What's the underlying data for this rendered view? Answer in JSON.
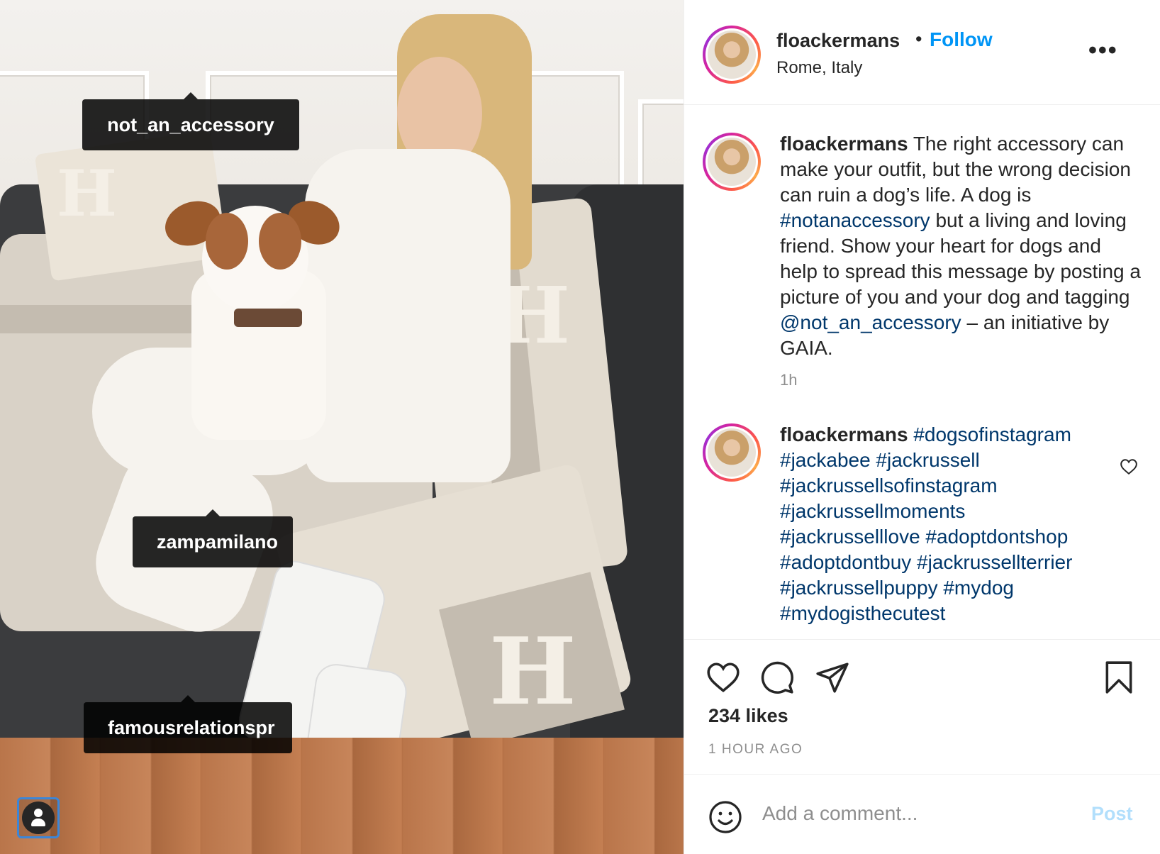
{
  "photo": {
    "tags": [
      "not_an_accessory",
      "zampamilano",
      "famousrelationspr"
    ],
    "user_tag_icon": "person-icon"
  },
  "header": {
    "username": "floackermans",
    "separator": "•",
    "follow_label": "Follow",
    "location": "Rome, Italy",
    "more_icon": "more-options-icon",
    "more_label": "•••"
  },
  "caption": {
    "username": "floackermans",
    "text_1": " The right accessory can make your outfit, but the wrong decision can ruin a dog’s life. A dog is ",
    "hashtag": "#notanaccessory",
    "text_2": " but a living and loving friend. Show your heart for dogs and help to spread this message by posting a picture of you and your dog and tagging ",
    "mention": "@not_an_accessory",
    "text_3": " – an initiative by GAIA.",
    "time": "1h"
  },
  "comment": {
    "username": "floackermans",
    "hashtags": "#dogsofinstagram #jackabee #jackrussell #jackrussellsofinstagram #jackrussellmoments #jackrusselllove #adoptdontshop #adoptdontbuy #jackrussellterrier #jackrussellpuppy #mydog #mydogisthecutest"
  },
  "actions": {
    "icons": [
      "heart-icon",
      "comment-icon",
      "share-icon",
      "bookmark-icon"
    ],
    "likes": "234 likes",
    "posted_ago": "1 HOUR AGO"
  },
  "add_comment": {
    "placeholder": "Add a comment...",
    "post_label": "Post"
  },
  "colors": {
    "accent": "#0095f6",
    "link": "#00376b",
    "muted": "#8e8e8e",
    "post_disabled": "#b2dffc"
  }
}
